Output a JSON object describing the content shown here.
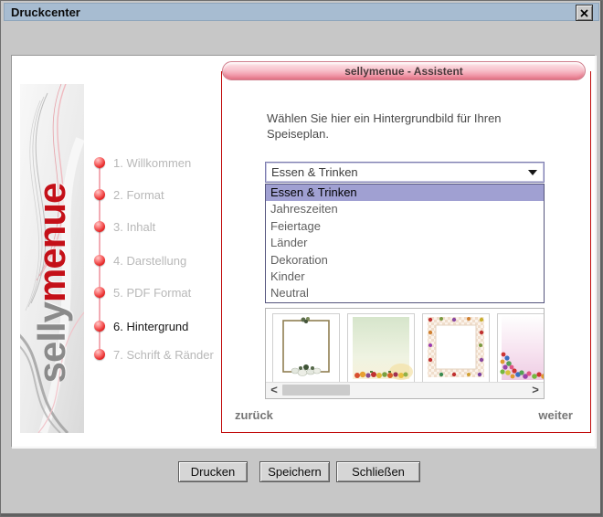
{
  "window": {
    "title": "Druckcenter"
  },
  "assistant": {
    "header_title": "sellymenue - Assistent",
    "logo": {
      "gray_text": "selly",
      "red_text": "menue"
    },
    "steps": [
      {
        "label": "1. Willkommen",
        "active": false
      },
      {
        "label": "2. Format",
        "active": false
      },
      {
        "label": "3. Inhalt",
        "active": false
      },
      {
        "label": "4. Darstellung",
        "active": false
      },
      {
        "label": "5. PDF Format",
        "active": false
      },
      {
        "label": "6. Hintergrund",
        "active": true
      },
      {
        "label": "7. Schrift & Ränder",
        "active": false
      }
    ],
    "content": {
      "instruction_line1": "Wählen Sie hier ein Hintergrundbild für Ihren",
      "instruction_line2": "Speiseplan.",
      "category_dropdown": {
        "selected_value": "Essen & Trinken",
        "options": [
          {
            "label": "Essen & Trinken",
            "highlighted": true
          },
          {
            "label": "Jahreszeiten",
            "highlighted": false
          },
          {
            "label": "Feiertage",
            "highlighted": false
          },
          {
            "label": "Länder",
            "highlighted": false
          },
          {
            "label": "Dekoration",
            "highlighted": false
          },
          {
            "label": "Kinder",
            "highlighted": false
          },
          {
            "label": "Neutral",
            "highlighted": false
          }
        ]
      },
      "thumbnails": [
        {
          "name": "background-olive-frame-vegetables"
        },
        {
          "name": "background-green-gradient-fruits"
        },
        {
          "name": "background-checkered-fruit-border"
        },
        {
          "name": "background-pink-gradient-sweets"
        }
      ],
      "back_label": "zurück",
      "next_label": "weiter"
    }
  },
  "footer": {
    "print_label": "Drucken",
    "save_label": "Speichern",
    "close_label": "Schließen"
  },
  "colors": {
    "titlebar_bg": "#a7bcd1",
    "window_bg": "#c7c7c7",
    "accent_red": "#c00a0a",
    "pill_top": "#fde7ea",
    "pill_bottom": "#ee8a9b",
    "selected_option_bg": "#a0a0d2",
    "logo_red": "#c41018",
    "logo_gray": "#8a8a8a",
    "step_inactive_text": "#b8b8b8",
    "step_active_text": "#161616"
  }
}
